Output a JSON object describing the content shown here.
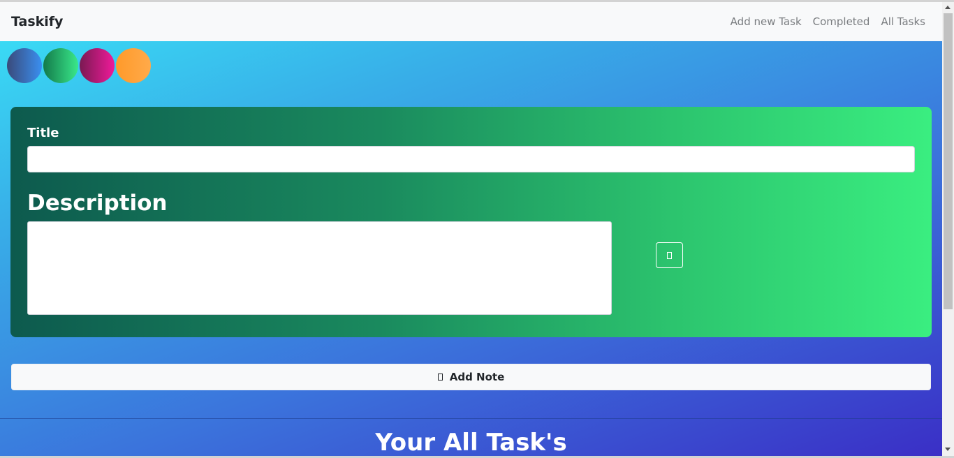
{
  "navbar": {
    "brand": "Taskify",
    "links": [
      "Add new Task",
      "Completed",
      "All Tasks"
    ]
  },
  "color_swatches": [
    {
      "name": "blue",
      "from": "#3a4a7a",
      "to": "#3a8ff0"
    },
    {
      "name": "green",
      "from": "#137a4a",
      "to": "#3ae88a"
    },
    {
      "name": "pink",
      "from": "#7a1a52",
      "to": "#f01a9a"
    },
    {
      "name": "orange",
      "from": "#ff9a2a",
      "to": "#ffaa4a"
    }
  ],
  "form": {
    "title_label": "Title",
    "title_value": "",
    "description_label": "Description",
    "description_value": ""
  },
  "actions": {
    "add_note_label": "Add Note"
  },
  "section": {
    "heading": "Your All Task's"
  },
  "colors": {
    "card_start": "#0d5a4e",
    "card_end": "#3aee80",
    "page_top": "#3ae3f7",
    "page_bottom": "#3a2fc6"
  }
}
